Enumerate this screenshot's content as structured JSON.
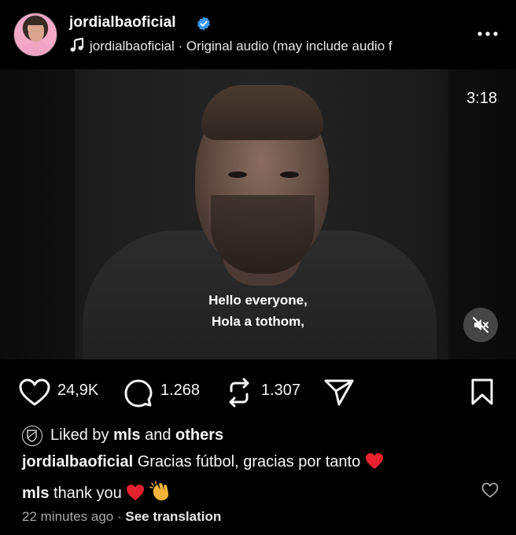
{
  "post": {
    "username": "jordialbaoficial",
    "verified_icon": "verified-badge-icon",
    "audio_owner": "jordialbaoficial",
    "audio_separator": " · ",
    "audio_label": "Original audio  (may include audio f"
  },
  "video": {
    "duration": "3:18",
    "subtitle_line1": "Hello everyone,",
    "subtitle_line2": "Hola a tothom,"
  },
  "actions": {
    "likes": "24,9K",
    "comments": "1.268",
    "reposts": "1.307"
  },
  "liked_by": {
    "prefix": "Liked by ",
    "user": "mls",
    "middle": " and ",
    "others": "others"
  },
  "caption": {
    "user": "jordialbaoficial",
    "text": " Gracias fútbol, gracias por tanto "
  },
  "comment": {
    "user": "mls",
    "text": " thank you "
  },
  "footer": {
    "time_ago": "22 minutes ago",
    "separator": " · ",
    "see_translation": "See translation"
  },
  "colors": {
    "background": "#000000",
    "verified": "#3897f0",
    "heart_emoji": "#e8212e",
    "muted_text": "#a8a8a8"
  }
}
